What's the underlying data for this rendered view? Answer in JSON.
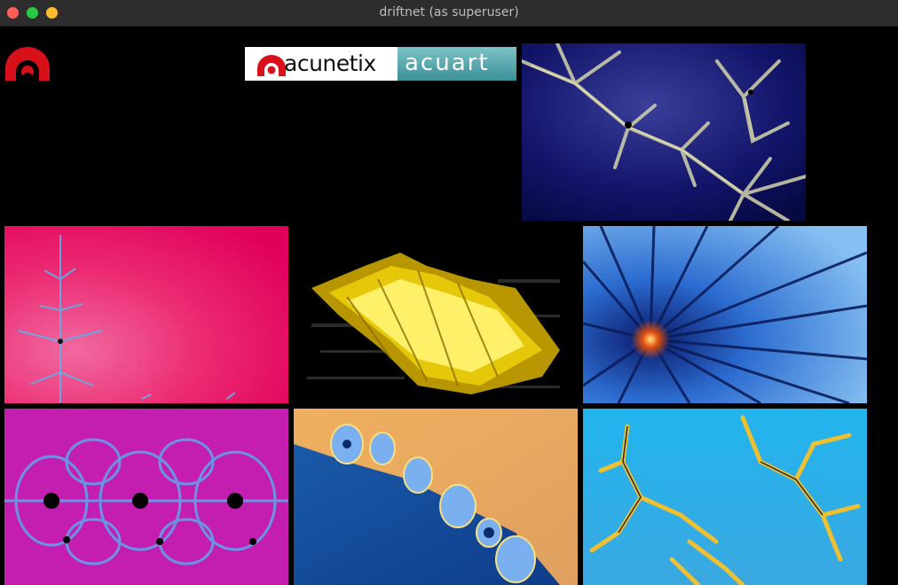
{
  "window": {
    "title": "driftnet (as superuser)",
    "controls": [
      "close",
      "minimize",
      "maximize"
    ]
  },
  "banner": {
    "left_word": "acunetix",
    "right_word": "acuart"
  },
  "colors": {
    "logo_red": "#d8101a",
    "background": "#000000"
  },
  "images": [
    {
      "name": "small-red-logo",
      "kind": "logo"
    },
    {
      "name": "acunetix-acuart-banner",
      "kind": "banner"
    },
    {
      "name": "fractal-blue-julia",
      "kind": "fractal"
    },
    {
      "name": "fractal-pink-red",
      "kind": "fractal"
    },
    {
      "name": "fractal-yellow-3d",
      "kind": "fractal"
    },
    {
      "name": "fractal-blue-starburst",
      "kind": "fractal"
    },
    {
      "name": "fractal-magenta-spirals",
      "kind": "fractal"
    },
    {
      "name": "fractal-blue-orange",
      "kind": "fractal"
    },
    {
      "name": "fractal-cyan-yellow",
      "kind": "fractal"
    }
  ]
}
